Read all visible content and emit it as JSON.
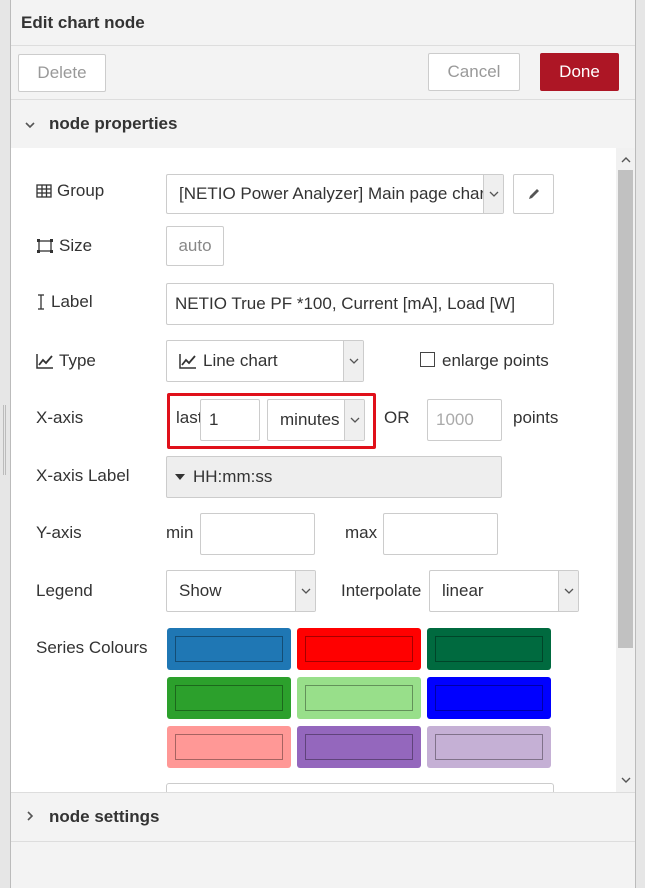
{
  "header": {
    "title": "Edit chart node"
  },
  "toolbar": {
    "delete_label": "Delete",
    "cancel_label": "Cancel",
    "done_label": "Done"
  },
  "sections": {
    "properties": {
      "label": "node properties",
      "icon": "chevron-down-icon"
    },
    "settings": {
      "label": "node settings",
      "icon": "chevron-right-icon"
    }
  },
  "form": {
    "group": {
      "label": "Group",
      "value": "[NETIO Power Analyzer] Main page chart"
    },
    "size": {
      "label": "Size",
      "value": "auto"
    },
    "label": {
      "label": "Label",
      "value": "NETIO True PF *100, Current [mA], Load [W]"
    },
    "type": {
      "label": "Type",
      "value": "Line chart",
      "enlarge_label": "enlarge points",
      "enlarge_checked": false
    },
    "xaxis": {
      "label": "X-axis",
      "last_label": "last",
      "last_value": "1",
      "unit": "minutes",
      "or_label": "OR",
      "points_placeholder": "1000",
      "points_label": "points"
    },
    "xaxis_label": {
      "label": "X-axis Label",
      "value": "HH:mm:ss"
    },
    "yaxis": {
      "label": "Y-axis",
      "min_label": "min",
      "min_value": "",
      "max_label": "max",
      "max_value": ""
    },
    "legend": {
      "label": "Legend",
      "value": "Show",
      "interpolate_label": "Interpolate",
      "interpolate_value": "linear"
    },
    "series_colours": {
      "label": "Series Colours",
      "colors": [
        "#1f77b4",
        "#ff0000",
        "#006a3f",
        "#2ca02c",
        "#98df8a",
        "#0000ff",
        "#ff9896",
        "#9467bd",
        "#c5b0d5"
      ]
    }
  },
  "accent": {
    "done": "#ad1625",
    "highlight": "#e0101a"
  }
}
